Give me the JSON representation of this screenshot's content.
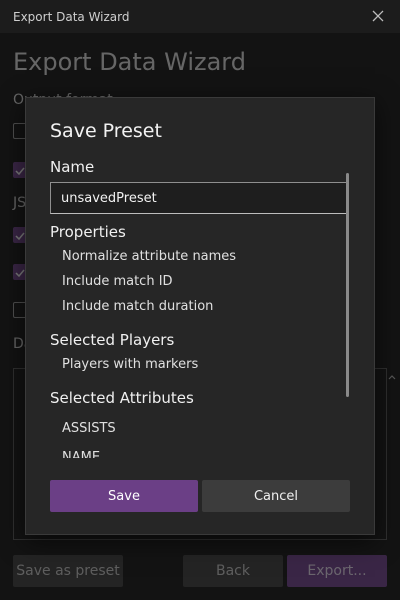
{
  "window": {
    "title_bar": "Export Data Wizard",
    "heading": "Export Data Wizard",
    "output_format_label": "Output format",
    "json_label": "JSON",
    "data_label": "Data",
    "buttons": {
      "save_as_preset": "Save as preset",
      "back": "Back",
      "export": "Export..."
    }
  },
  "modal": {
    "title": "Save Preset",
    "name_label": "Name",
    "name_value": "unsavedPreset",
    "properties_label": "Properties",
    "properties": [
      "Normalize attribute names",
      "Include match ID",
      "Include match duration"
    ],
    "selected_players_label": "Selected Players",
    "selected_players": [
      "Players with markers"
    ],
    "selected_attributes_label": "Selected Attributes",
    "selected_attributes": [
      "ASSISTS",
      "NAME"
    ],
    "save_label": "Save",
    "cancel_label": "Cancel"
  },
  "colors": {
    "accent": "#6b3f86",
    "background": "#1b1b1b",
    "modal": "#262626"
  },
  "icons": {
    "close": "close-icon",
    "checkmark": "check-icon",
    "scroll_up": "chevron-up-icon"
  }
}
